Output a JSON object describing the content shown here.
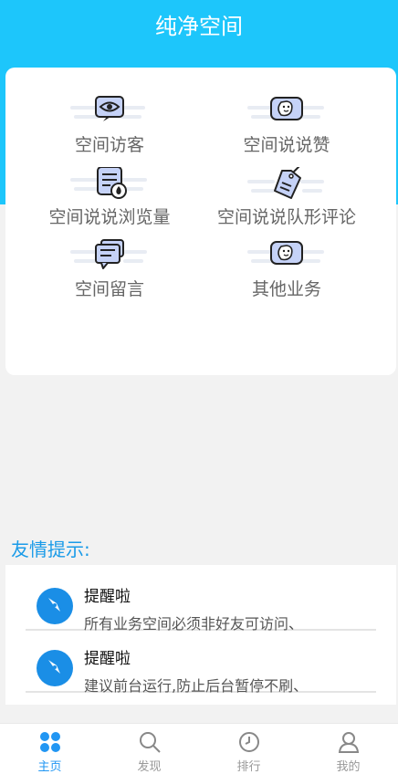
{
  "header": {
    "title": "纯净空间"
  },
  "grid": [
    {
      "label": "空间访客",
      "icon": "eye-icon"
    },
    {
      "label": "空间说说赞",
      "icon": "smile-chat-icon"
    },
    {
      "label": "空间说说浏览量",
      "icon": "document-fire-icon"
    },
    {
      "label": "空间说说队形评论",
      "icon": "tag-icon"
    },
    {
      "label": "空间留言",
      "icon": "message-icon"
    },
    {
      "label": "其他业务",
      "icon": "smile-chat-icon"
    }
  ],
  "tips": {
    "title": "友情提示:",
    "items": [
      {
        "title": "提醒啦",
        "desc": "所有业务空间必须非好友可访问、"
      },
      {
        "title": "提醒啦",
        "desc": "建议前台运行,防止后台暂停不刷、"
      }
    ]
  },
  "tabbar": [
    {
      "label": "主页",
      "icon": "home-grid-icon",
      "active": true
    },
    {
      "label": "发现",
      "icon": "search-icon"
    },
    {
      "label": "排行",
      "icon": "clock-icon"
    },
    {
      "label": "我的",
      "icon": "user-icon"
    }
  ],
  "colors": {
    "primary": "#1dc6fb",
    "accent": "#2196f3",
    "icon_fill": "#c5d2f7",
    "icon_stroke": "#222222"
  }
}
